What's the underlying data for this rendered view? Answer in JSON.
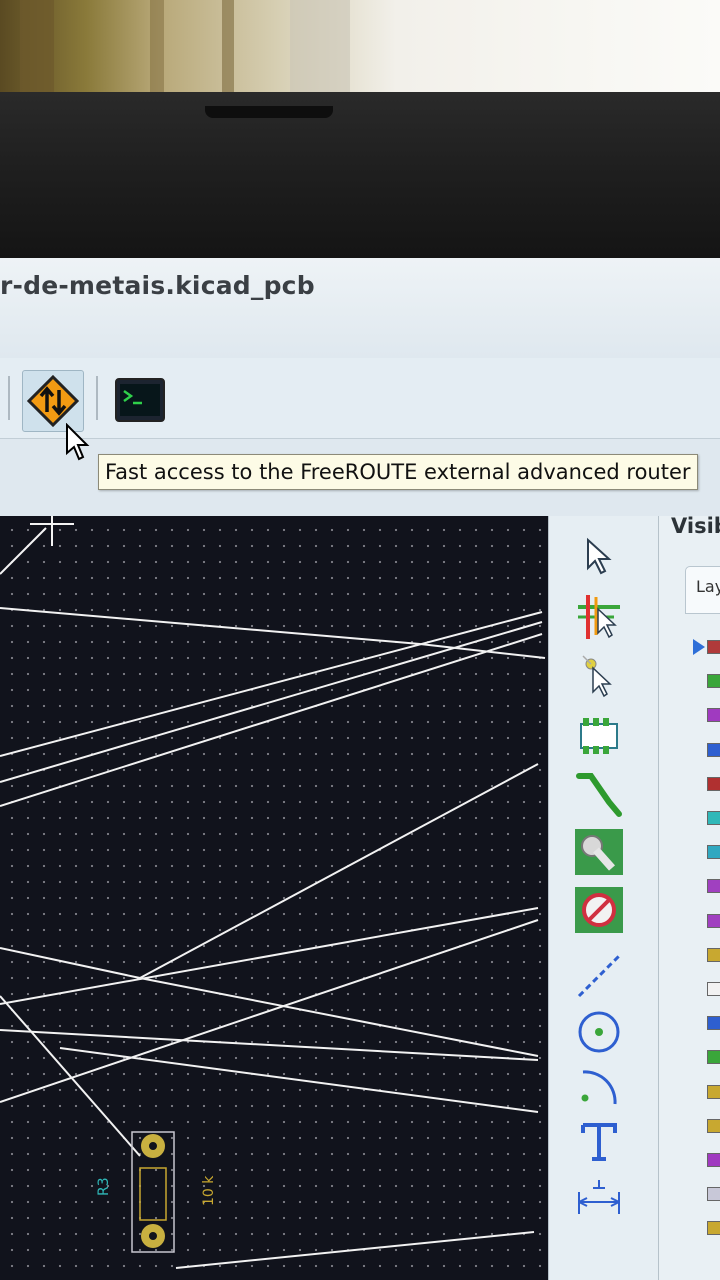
{
  "window": {
    "title": "r-de-metais.kicad_pcb"
  },
  "toolbar": {
    "freeroute_button": {
      "icon": "freeroute-router-icon",
      "state": "hovered"
    },
    "scripting_console_button": {
      "icon": "terminal-icon"
    }
  },
  "tooltip": {
    "text": "Fast access to the FreeROUTE external advanced router"
  },
  "canvas": {
    "component": {
      "reference": "R3",
      "value": "10 k"
    }
  },
  "right_toolbar": {
    "tools": [
      {
        "name": "select",
        "icon": "cursor-arrow-icon"
      },
      {
        "name": "highlight-net",
        "icon": "highlight-net-icon"
      },
      {
        "name": "local-ratsnest",
        "icon": "local-ratsnest-icon"
      },
      {
        "name": "add-footprint",
        "icon": "footprint-icon"
      },
      {
        "name": "route-tracks",
        "icon": "route-track-icon"
      },
      {
        "name": "add-zone",
        "icon": "zone-icon"
      },
      {
        "name": "add-keepout",
        "icon": "keepout-icon"
      },
      {
        "name": "add-line",
        "icon": "graphic-line-icon"
      },
      {
        "name": "add-circle",
        "icon": "circle-icon"
      },
      {
        "name": "add-arc",
        "icon": "arc-icon"
      },
      {
        "name": "add-text",
        "icon": "text-icon"
      },
      {
        "name": "add-dimension",
        "icon": "dimension-icon"
      }
    ]
  },
  "layers_panel": {
    "title": "Visib",
    "tab_label": "Lay",
    "active_layer_index": 0,
    "swatch_colors": [
      "#b03a3a",
      "#3aa63a",
      "#a03ac0",
      "#2e5fd0",
      "#b03030",
      "#30b8b8",
      "#30a8c0",
      "#a040c0",
      "#a040c0",
      "#c8a830",
      "#f2f2f2",
      "#2e5fd0",
      "#3aa63a",
      "#c8a830",
      "#c8a830",
      "#a03ac0",
      "#c8c8d8",
      "#c8a830"
    ]
  },
  "colors": {
    "canvas_bg": "#11131c",
    "ratsnest": "#f0f0f0",
    "pad": "#c8b040",
    "reference_text": "#2fb8b8",
    "value_text": "#c8a830"
  }
}
